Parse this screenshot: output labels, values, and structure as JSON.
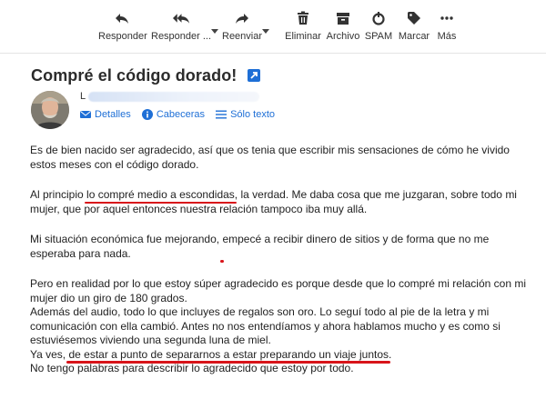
{
  "toolbar": {
    "buttons": [
      {
        "label": "Responder",
        "icon": "reply-icon"
      },
      {
        "label": "Responder ...",
        "icon": "reply-all-icon"
      },
      {
        "label": "Reenviar",
        "icon": "forward-icon"
      },
      {
        "label": "Eliminar",
        "icon": "trash-icon"
      },
      {
        "label": "Archivo",
        "icon": "archive-icon"
      },
      {
        "label": "SPAM",
        "icon": "spam-icon"
      },
      {
        "label": "Marcar",
        "icon": "tag-icon"
      },
      {
        "label": "Más",
        "icon": "more-icon"
      }
    ]
  },
  "message": {
    "subject": "Compré el código dorado!",
    "sender_initial": "L",
    "header_links": {
      "details": "Detalles",
      "headers": "Cabeceras",
      "plain_text": "Sólo texto"
    },
    "p1": "Es de bien nacido ser agradecido, así que os tenia que escribir mis sensaciones de cómo he vivido estos meses con el código dorado.",
    "p2_a": "Al principio ",
    "p2_mark": "lo compré medio a escondidas",
    "p2_b": ", la verdad. Me daba cosa que me juzgaran, sobre todo mi mujer, que por aquel entonces nuestra relación tampoco iba muy allá.",
    "p3_a": "Mi situación económica fue mejorando, ",
    "p3_mark": "empecé a recibir dinero de sitios y de forma que no me esperaba para nada",
    "p3_b": ".",
    "p4_l1": "Pero en realidad por lo que estoy súper agradecido es porque desde que lo compré mi relación con mi mujer dio un giro de 180 grados.",
    "p4_l2": "Además del audio, todo lo que incluyes de regalos son oro. Lo seguí todo al pie de la letra y mi comunicación con ella cambió. Antes no nos entendíamos y ahora hablamos mucho y es como si estuviésemos viviendo una segunda luna de miel.",
    "p4_l3_a": "Ya ves, ",
    "p4_l3_mark": "de estar a punto de separarnos a estar preparando un viaje juntos",
    "p4_l3_b": ".",
    "p4_l4": "No tengo palabras para describir lo agradecido que estoy por todo."
  },
  "colors": {
    "accent": "#1e6fd6",
    "underline": "#d8141a",
    "toolbar_icon": "#333333"
  }
}
